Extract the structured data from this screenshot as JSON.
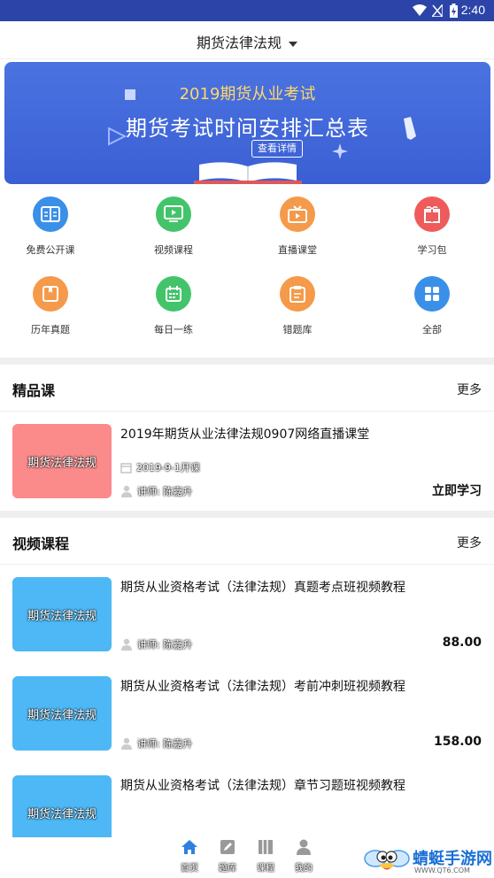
{
  "status_bar": {
    "time": "2:40"
  },
  "header": {
    "title": "期货法律法规"
  },
  "banner": {
    "subtitle": "2019期货从业考试",
    "title": "期货考试时间安排汇总表",
    "button": "查看详情"
  },
  "menu": [
    {
      "label": "免费公开课",
      "icon": "open-course-icon",
      "color": "#3a8fe8"
    },
    {
      "label": "视频课程",
      "icon": "video-course-icon",
      "color": "#43c46b"
    },
    {
      "label": "直播课堂",
      "icon": "live-class-icon",
      "color": "#f59a4a"
    },
    {
      "label": "学习包",
      "icon": "gift-package-icon",
      "color": "#ef5b5b"
    },
    {
      "label": "历年真题",
      "icon": "past-papers-icon",
      "color": "#f59a4a"
    },
    {
      "label": "每日一练",
      "icon": "calendar-icon",
      "color": "#43c46b"
    },
    {
      "label": "错题库",
      "icon": "clipboard-icon",
      "color": "#f59a4a"
    },
    {
      "label": "全部",
      "icon": "grid-icon",
      "color": "#3a8fe8"
    }
  ],
  "featured": {
    "title": "精品课",
    "more": "更多",
    "course": {
      "thumb_text": "期货法律法规",
      "title": "2019年期货从业法律法规0907网络直播课堂",
      "date": "2019-9-1开课",
      "teacher": "讲师: 陈嘉升",
      "action": "立即学习",
      "thumb_color": "#fb8a8a"
    }
  },
  "videos": {
    "title": "视频课程",
    "more": "更多",
    "items": [
      {
        "thumb_text": "期货法律法规",
        "title": "期货从业资格考试（法律法规）真题考点班视频教程",
        "teacher": "讲师: 陈嘉升",
        "price": "88.00"
      },
      {
        "thumb_text": "期货法律法规",
        "title": "期货从业资格考试（法律法规）考前冲刺班视频教程",
        "teacher": "讲师: 陈嘉升",
        "price": "158.00"
      },
      {
        "thumb_text": "期货法律法规",
        "title": "期货从业资格考试（法律法规）章节习题班视频教程",
        "teacher": "",
        "price": ""
      }
    ],
    "thumb_color": "#4db8f5"
  },
  "tabbar": [
    {
      "label": "首页",
      "icon": "home-icon",
      "active": true
    },
    {
      "label": "题库",
      "icon": "edit-icon",
      "active": false
    },
    {
      "label": "课程",
      "icon": "book-icon",
      "active": false
    },
    {
      "label": "我的",
      "icon": "user-icon",
      "active": false
    }
  ],
  "watermark": {
    "text": "蜻蜓手游网",
    "url": "WWW.QT6.COM"
  }
}
